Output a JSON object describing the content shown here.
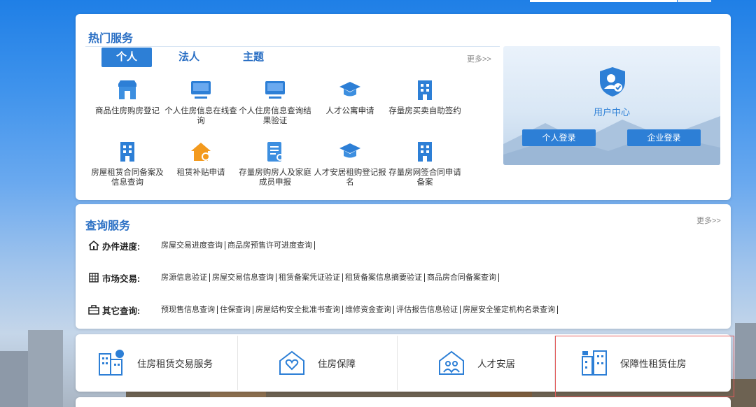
{
  "hot": {
    "title": "热门服务",
    "tabs": [
      "个人",
      "法人",
      "主题"
    ],
    "more": "更多>>",
    "services": [
      {
        "label": "商品住房购房登记",
        "icon": "store-icon"
      },
      {
        "label": "个人住房信息在线查询",
        "icon": "monitor-icon"
      },
      {
        "label": "个人住房信息查询结果验证",
        "icon": "monitor-icon"
      },
      {
        "label": "人才公寓申请",
        "icon": "graduation-cap-icon"
      },
      {
        "label": "存量房买卖自助签约",
        "icon": "building-icon"
      },
      {
        "label": "房屋租赁合同备案及信息查询",
        "icon": "building-icon"
      },
      {
        "label": "租赁补贴申请",
        "icon": "house-coin-icon"
      },
      {
        "label": "存量房购房人及家庭成员申报",
        "icon": "document-search-icon"
      },
      {
        "label": "人才安居租购登记报名",
        "icon": "graduation-cap-icon"
      },
      {
        "label": "存量房网签合同申请备案",
        "icon": "building-icon"
      }
    ]
  },
  "user_center": {
    "title": "用户中心",
    "personal_login": "个人登录",
    "company_login": "企业登录"
  },
  "query": {
    "title": "查询服务",
    "more": "更多>>",
    "rows": [
      {
        "label": "办件进度:",
        "icon": "home-icon",
        "links": [
          "房屋交易进度查询",
          "商品房预售许可进度查询"
        ]
      },
      {
        "label": "市场交易:",
        "icon": "building-grid-icon",
        "links": [
          "房源信息验证",
          "房屋交易信息查询",
          "租赁备案凭证验证",
          "租赁备案信息摘要验证",
          "商品房合同备案查询"
        ]
      },
      {
        "label": "其它查询:",
        "icon": "briefcase-icon",
        "links": [
          "预现售信息查询",
          "住保查询",
          "房屋结构安全批准书查询",
          "维修资金查询",
          "评估报告信息验证",
          "房屋安全鉴定机构名录查询"
        ]
      }
    ]
  },
  "quick": [
    {
      "label": "住房租赁交易服务",
      "icon": "rental-building-icon"
    },
    {
      "label": "住房保障",
      "icon": "house-heart-icon"
    },
    {
      "label": "人才安居",
      "icon": "house-people-icon"
    },
    {
      "label": "保障性租赁住房",
      "icon": "buildings-icon"
    }
  ],
  "colors": {
    "accent": "#2d7fd6",
    "title": "#2a6fc4",
    "highlight": "#e25b5b"
  }
}
